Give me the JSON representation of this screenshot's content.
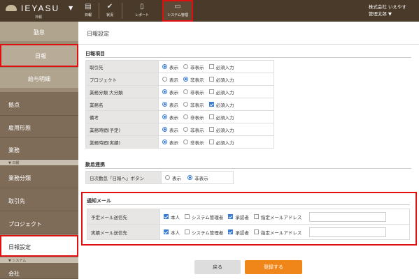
{
  "app": {
    "logo_text": "IEYASU",
    "logo_sub": "日報",
    "logo_caret": "▼"
  },
  "topnav": [
    {
      "label": "日報",
      "icon": "book-icon",
      "glyph": "▤"
    },
    {
      "label": "状況",
      "icon": "check-icon",
      "glyph": "✔"
    },
    {
      "label": "レポート",
      "icon": "document-icon",
      "glyph": "▯"
    },
    {
      "label": "システム管理",
      "icon": "monitor-icon",
      "glyph": "▭"
    }
  ],
  "user": {
    "company": "株式会社 いえやす",
    "name": "管理太郎",
    "caret": "▼"
  },
  "sidebar": {
    "top_items": [
      {
        "label": "勤怠"
      },
      {
        "label": "日報"
      },
      {
        "label": "給与明細"
      }
    ],
    "items_a": [
      {
        "label": "拠点"
      },
      {
        "label": "雇用形態"
      },
      {
        "label": "業務"
      }
    ],
    "section_nippo": "▼ 日報",
    "items_b": [
      {
        "label": "業務分類"
      },
      {
        "label": "取引先"
      },
      {
        "label": "プロジェクト"
      },
      {
        "label": "日報設定"
      }
    ],
    "section_system": "▼ システム",
    "items_c": [
      {
        "label": "会社"
      }
    ]
  },
  "page": {
    "title": "日報設定"
  },
  "items_section": {
    "title": "日報項目",
    "show_label": "表示",
    "hide_label": "非表示",
    "required_label": "必須入力",
    "rows": [
      {
        "label": "取引先",
        "show": true,
        "required": false
      },
      {
        "label": "プロジェクト",
        "show": false,
        "required": false
      },
      {
        "label": "業務分類 大分類",
        "show": true,
        "required": false
      },
      {
        "label": "業務名",
        "show": true,
        "required": true
      },
      {
        "label": "備考",
        "show": true,
        "required": false
      },
      {
        "label": "業務時間(予定)",
        "show": true,
        "required": false
      },
      {
        "label": "業務時間(実績)",
        "show": true,
        "required": false
      }
    ]
  },
  "link_section": {
    "title": "勤怠連携",
    "row": {
      "label": "日次勤怠「日報へ」ボタン",
      "show": false
    }
  },
  "notify_section": {
    "title": "通知メール",
    "options": {
      "self": "本人",
      "sysadmin": "システム管理者",
      "approver": "承認者",
      "specified": "指定メールアドレス"
    },
    "rows": [
      {
        "label": "予定メール送信先",
        "self": true,
        "sysadmin": false,
        "approver": true,
        "specified": false,
        "email": ""
      },
      {
        "label": "実績メール送信先",
        "self": true,
        "sysadmin": false,
        "approver": true,
        "specified": false,
        "email": ""
      }
    ]
  },
  "buttons": {
    "back": "戻る",
    "submit": "登録する"
  },
  "colors": {
    "topbar": "#4a3a2a",
    "sidebar": "#9a8a76",
    "accent": "#f0861a",
    "highlight": "#e01010",
    "radio_blue": "#3a7bd5"
  }
}
